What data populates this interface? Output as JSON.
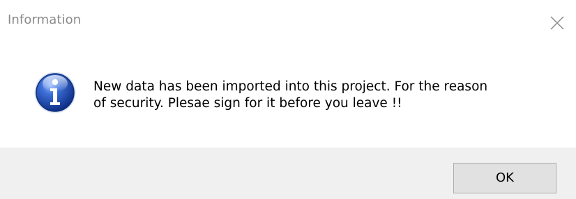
{
  "dialog": {
    "title": "Information",
    "icon": "information-icon",
    "message": "New data has been imported into this project. For the reason\nof security. Plesae sign for it before you leave !!",
    "close_icon": "close-icon",
    "ok_label": "OK"
  },
  "colors": {
    "title_text": "#8a8a8a",
    "footer_background": "#f0f0f0",
    "button_background": "#e1e1e1",
    "button_border": "#adadad",
    "icon_blue": "#1f4fb8"
  }
}
